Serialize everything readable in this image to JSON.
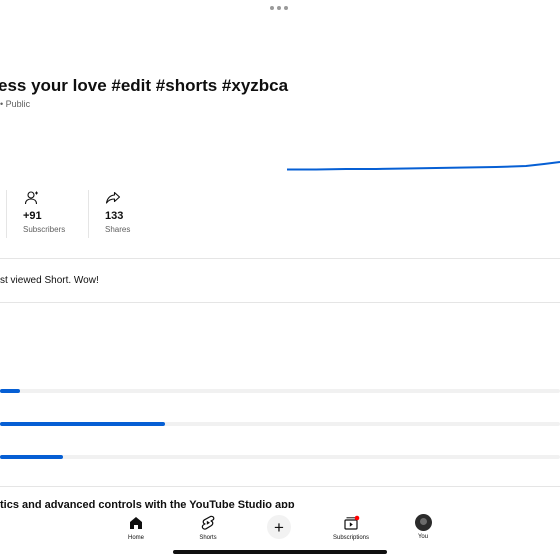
{
  "video": {
    "title": "ess your love #edit #shorts #xyzbca",
    "visibility": "• Public"
  },
  "stats": [
    {
      "icon": "person-add-icon",
      "value": "+91",
      "label": "Subscribers"
    },
    {
      "icon": "share-icon",
      "value": "133",
      "label": "Shares"
    }
  ],
  "message": "st viewed Short. Wow!",
  "bars": [
    {
      "fraction": 0.036
    },
    {
      "fraction": 0.294
    },
    {
      "fraction": 0.112
    }
  ],
  "promo": "tics and advanced controls with the YouTube Studio app",
  "nav": {
    "home": "Home",
    "shorts": "Shorts",
    "create": "+",
    "subscriptions": "Subscriptions",
    "you": "You"
  },
  "colors": {
    "accent": "#065fd4",
    "notification_dot": "#ff0000"
  }
}
